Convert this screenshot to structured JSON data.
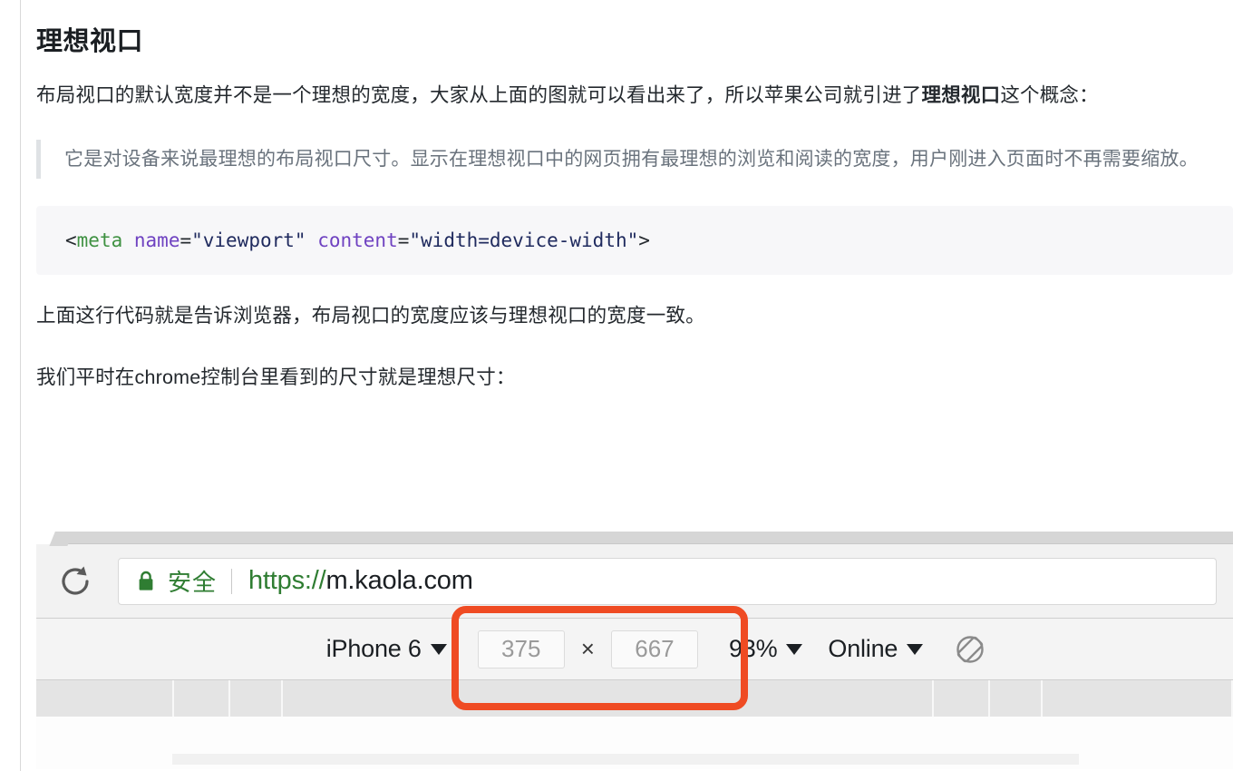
{
  "article": {
    "heading": "理想视口",
    "paragraph_1": {
      "part_1": "布局视口的默认宽度并不是一个理想的宽度，大家从上面的图就可以看出来了，所以苹果公司就引进了",
      "bold_1": "理想视口",
      "part_2": "这个概念："
    },
    "blockquote": "它是对设备来说最理想的布局视口尺寸。显示在理想视口中的网页拥有最理想的浏览和阅读的宽度，用户刚进入页面时不再需要缩放。",
    "code": {
      "punct_open": "<",
      "tag": "meta",
      "space_1": " ",
      "attr_name": "name",
      "eq_1": "=",
      "value_name": "\"viewport\"",
      "space_2": " ",
      "attr_content": "content",
      "eq_2": "=",
      "value_content": "\"width=device-width\"",
      "punct_close": ">"
    },
    "paragraph_2": "上面这行代码就是告诉浏览器，布局视口的宽度应该与理想视口的宽度一致。",
    "paragraph_3": "我们平时在chrome控制台里看到的尺寸就是理想尺寸："
  },
  "browser": {
    "reload_icon": "reload-icon",
    "lock_icon": "lock-icon",
    "secure_label": "安全",
    "url_scheme": "https://",
    "url_host": "m.kaola.com",
    "device_toolbar": {
      "device_name": "iPhone 6",
      "device_caret": "▼",
      "width_value": "375",
      "separator": "×",
      "height_value": "667",
      "zoom_value": "93%",
      "zoom_caret": "▼",
      "network_value": "Online",
      "network_caret": "▼",
      "rotate_icon": "rotate-screen-icon"
    }
  },
  "colors": {
    "highlight": "#ef4b23",
    "secure_green": "#2f7d32",
    "code_tag": "#3f9142",
    "code_attr": "#6f42c1",
    "code_string": "#1f2a5e",
    "quote_text": "#6a737d"
  }
}
